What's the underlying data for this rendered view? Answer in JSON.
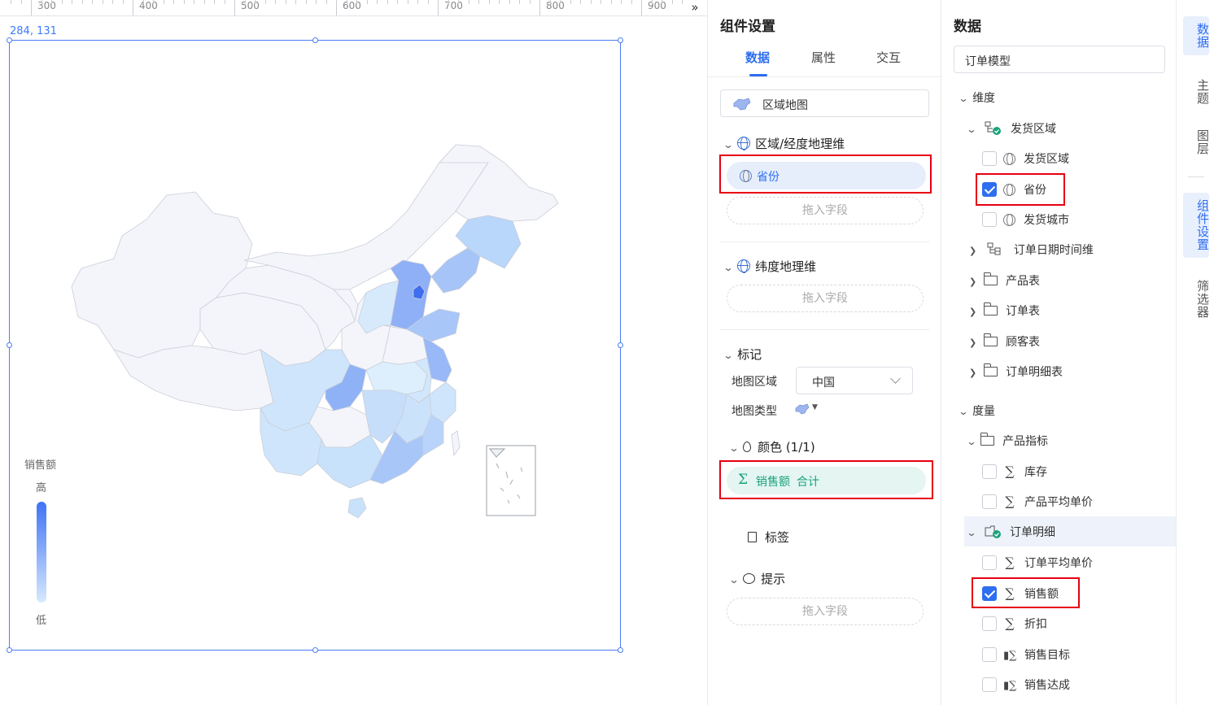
{
  "ruler": {
    "labels": [
      "300",
      "400",
      "500",
      "600",
      "700",
      "800",
      "900"
    ],
    "toggle": "»"
  },
  "canvas": {
    "coords": "284, 131"
  },
  "legend": {
    "title": "销售额",
    "high": "高",
    "low": "低",
    "colors": {
      "high": "#3f72f5",
      "low": "#d7e9fd"
    }
  },
  "settings": {
    "title": "组件设置",
    "tabs": [
      "数据",
      "属性",
      "交互"
    ],
    "active_tab": "数据",
    "chart_type": "区域地图",
    "region_section": "区域/经度地理维",
    "region_field": "省份",
    "drop_placeholder": "拖入字段",
    "lat_section": "纬度地理维",
    "marker_section": "标记",
    "map_area_label": "地图区域",
    "map_area_value": "中国",
    "map_type_label": "地图类型",
    "color_section": "颜色 (1/1)",
    "color_field": "销售额",
    "color_field_agg": "合计",
    "label_section": "标签",
    "tooltip_section": "提示"
  },
  "data_panel": {
    "title": "数据",
    "model": "订单模型",
    "dimension_group": "维度",
    "dimensions": [
      {
        "label": "发货区域",
        "type": "hierarchy"
      },
      {
        "label": "发货区域",
        "type": "geo",
        "checked": false
      },
      {
        "label": "省份",
        "type": "geo",
        "checked": true
      },
      {
        "label": "发货城市",
        "type": "geo",
        "checked": false
      },
      {
        "label": "订单日期时间维",
        "type": "hierarchy"
      },
      {
        "label": "产品表",
        "type": "folder"
      },
      {
        "label": "订单表",
        "type": "folder"
      },
      {
        "label": "顾客表",
        "type": "folder"
      },
      {
        "label": "订单明细表",
        "type": "folder"
      }
    ],
    "measure_group": "度量",
    "measures": [
      {
        "label": "产品指标",
        "type": "folder"
      },
      {
        "label": "库存",
        "type": "sum",
        "checked": false
      },
      {
        "label": "产品平均单价",
        "type": "sum",
        "checked": false
      },
      {
        "label": "订单明细",
        "type": "folder"
      },
      {
        "label": "订单平均单价",
        "type": "sum",
        "checked": false
      },
      {
        "label": "销售额",
        "type": "sum",
        "checked": true
      },
      {
        "label": "折扣",
        "type": "sum",
        "checked": false
      },
      {
        "label": "销售目标",
        "type": "calc",
        "checked": false
      },
      {
        "label": "销售达成",
        "type": "calc",
        "checked": false
      }
    ]
  },
  "side_tabs": [
    "数据",
    "主题",
    "图层",
    "组件设置",
    "筛选器"
  ],
  "active_side_tab": "组件设置"
}
